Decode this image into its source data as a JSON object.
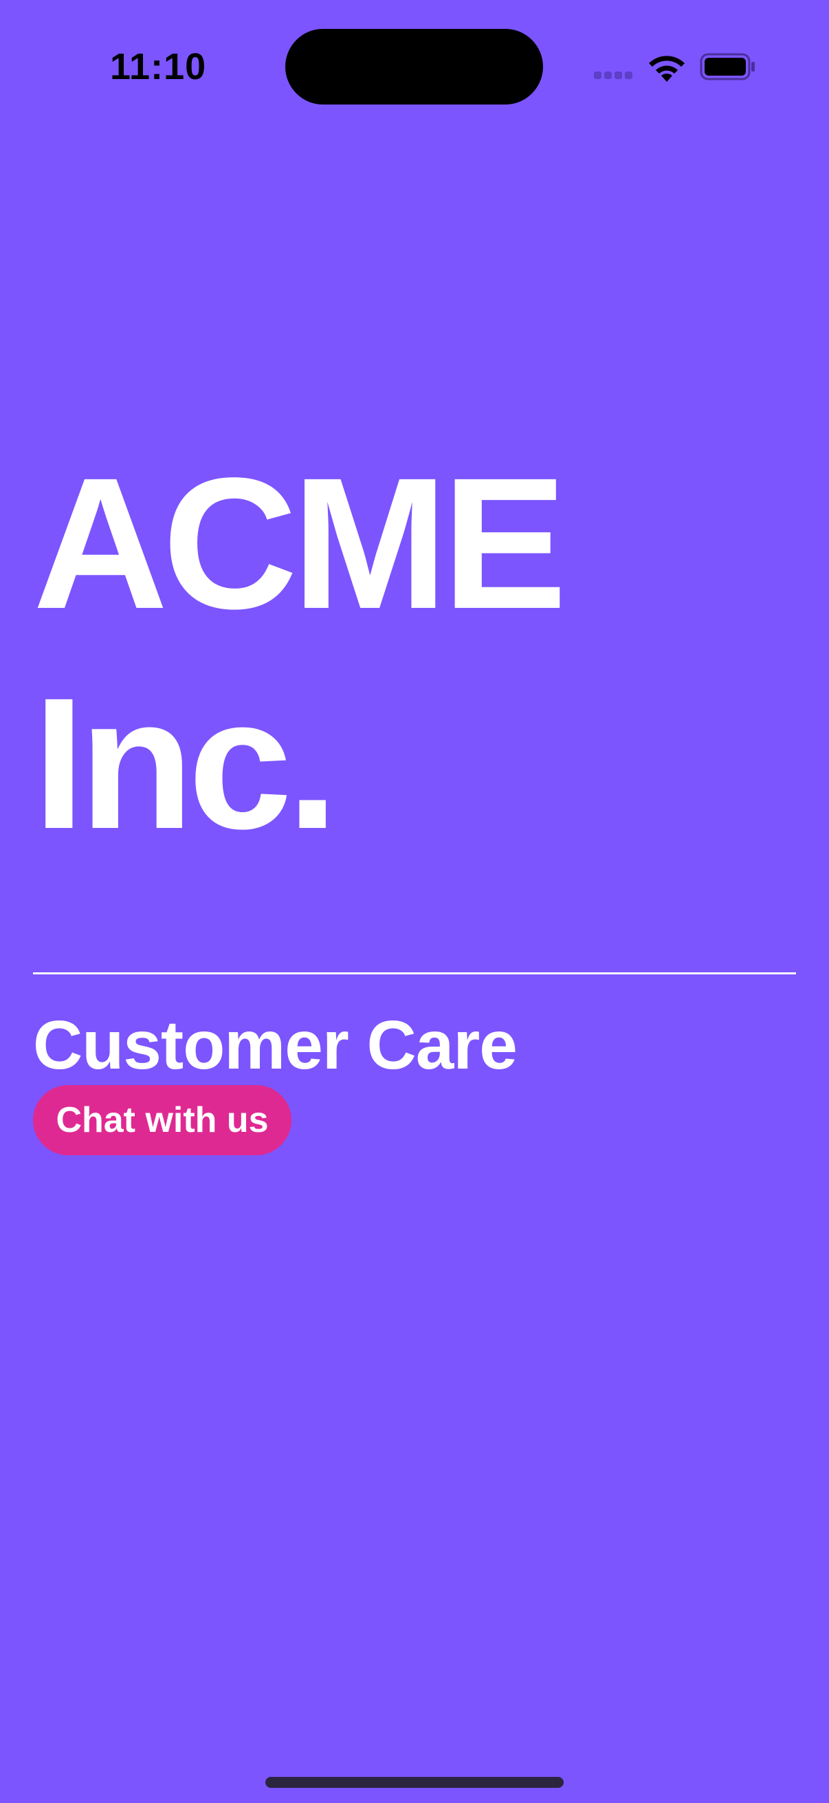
{
  "status_bar": {
    "time": "11:10",
    "icons": [
      "cell-signal-icon",
      "wifi-icon",
      "battery-icon"
    ]
  },
  "hero": {
    "line1": "ACME",
    "line2": "Inc."
  },
  "section": {
    "title": "Customer Care"
  },
  "chat_button": {
    "label": "Chat with us"
  },
  "colors": {
    "background": "#7C55FE",
    "accent": "#DF2992",
    "text": "#FFFFFF"
  }
}
